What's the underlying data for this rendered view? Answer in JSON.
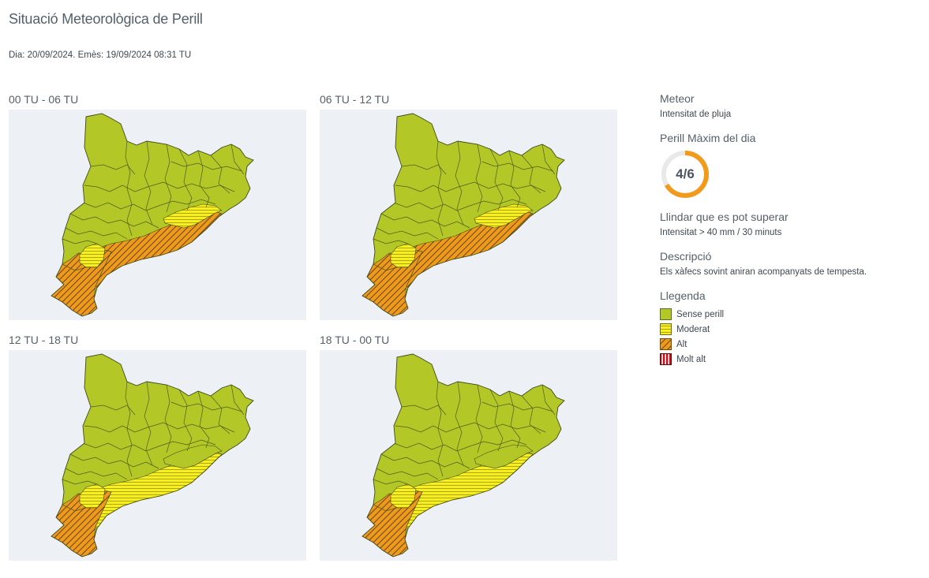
{
  "header": {
    "title": "Situació Meteorològica de Perill",
    "issued": "Dia: 20/09/2024. Emès: 19/09/2024 08:31 TU"
  },
  "periods": [
    {
      "label": "00 TU - 06 TU",
      "levels": {
        "litoral_sud": "alt",
        "litoral_central": "alt",
        "nord_litoral": "moderat",
        "ebre_interior": "moderat"
      }
    },
    {
      "label": "06 TU - 12 TU",
      "levels": {
        "litoral_sud": "alt",
        "litoral_central": "alt",
        "nord_litoral": "moderat",
        "ebre_interior": "moderat"
      }
    },
    {
      "label": "12 TU - 18 TU",
      "levels": {
        "litoral_sud": "alt",
        "litoral_central": "moderat",
        "nord_litoral": "sense",
        "ebre_interior": "moderat"
      }
    },
    {
      "label": "18 TU - 00 TU",
      "levels": {
        "litoral_sud": "alt",
        "litoral_central": "moderat",
        "nord_litoral": "sense",
        "ebre_interior": "moderat"
      }
    }
  ],
  "sidebar": {
    "meteor_heading": "Meteor",
    "meteor_value": "Intensitat de pluja",
    "max_heading": "Perill Màxim del dia",
    "max_level": 4,
    "max_scale": 6,
    "max_text": "4/6",
    "threshold_heading": "Llindar que es pot superar",
    "threshold_value": "Intensitat > 40 mm / 30 minuts",
    "description_heading": "Descripció",
    "description_value": "Els xàfecs sovint aniran acompanyats de tempesta.",
    "legend_heading": "Llegenda",
    "legend": [
      {
        "label": "Sense perill",
        "key": "sense"
      },
      {
        "label": "Moderat",
        "key": "moderat"
      },
      {
        "label": "Alt",
        "key": "alt"
      },
      {
        "label": "Molt alt",
        "key": "molt_alt"
      }
    ]
  },
  "colors": {
    "sense": "#b3c726",
    "moderat": "#f7f01c",
    "alt": "#ee9a1a",
    "molt_alt": "#c4121d",
    "gauge": "#f29a1b",
    "map_bg": "#edf1f6"
  }
}
